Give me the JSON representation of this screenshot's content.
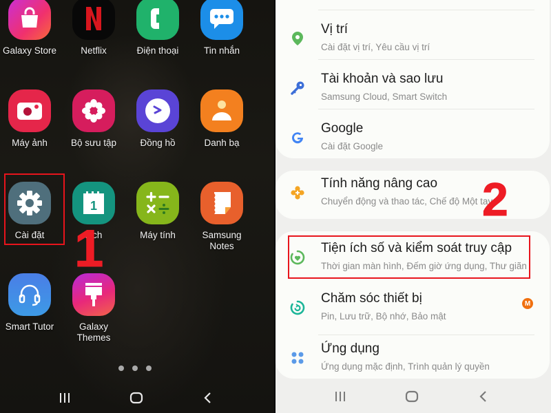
{
  "home_screen": {
    "apps": [
      {
        "label": "Galaxy Store",
        "icon": "shopping-bag-icon",
        "color": "#e0307a"
      },
      {
        "label": "Netflix",
        "icon": "netflix-n-icon",
        "color": "#000000"
      },
      {
        "label": "Điện thoại",
        "icon": "phone-icon",
        "color": "#21b06a"
      },
      {
        "label": "Tin nhắn",
        "icon": "chat-bubble-icon",
        "color": "#1e8ee6"
      },
      {
        "label": "Máy ảnh",
        "icon": "camera-icon",
        "color": "#e5264a"
      },
      {
        "label": "Bộ sưu tập",
        "icon": "flower-icon",
        "color": "#d61d5d"
      },
      {
        "label": "Đồng hồ",
        "icon": "clock-icon",
        "color": "#5a44d6"
      },
      {
        "label": "Danh bạ",
        "icon": "contact-icon",
        "color": "#f3801f"
      },
      {
        "label": "Cài đặt",
        "icon": "gear-icon",
        "color": "#4f6f7c"
      },
      {
        "label": "Lịch",
        "icon": "calendar-icon",
        "color": "#14947f"
      },
      {
        "label": "Máy tính",
        "icon": "calculator-icon",
        "color": "#86b61b"
      },
      {
        "label": "Samsung Notes",
        "icon": "notes-icon",
        "color": "#e8602c"
      },
      {
        "label": "Smart Tutor",
        "icon": "headset-icon",
        "color": "#3f86e0"
      },
      {
        "label": "Galaxy Themes",
        "icon": "paintbrush-icon",
        "color": "#d8269a"
      }
    ],
    "calendar_day": "1",
    "page_indicator_count": 3,
    "step_label": "1"
  },
  "settings_screen": {
    "groups": [
      {
        "items": [
          {
            "title": "Vị trí",
            "subtitle": "Cài đặt vị trí, Yêu cầu vị trí",
            "icon": "location-pin-icon",
            "icon_color": "#5cb85c"
          },
          {
            "title": "Tài khoản và sao lưu",
            "subtitle": "Samsung Cloud, Smart Switch",
            "icon": "key-icon",
            "icon_color": "#3d6fd8"
          },
          {
            "title": "Google",
            "subtitle": "Cài đặt Google",
            "icon": "google-g-icon",
            "icon_color": "#4285f4"
          }
        ]
      },
      {
        "items": [
          {
            "title": "Tính năng nâng cao",
            "subtitle": "Chuyển động và thao tác, Chế độ Một tay",
            "icon": "advanced-features-icon",
            "icon_color": "#f4a524"
          }
        ]
      },
      {
        "items": [
          {
            "title": "Tiện ích số và kiểm soát truy cập",
            "subtitle": "Thời gian màn hình, Đếm giờ ứng dụng, Thư giãn",
            "icon": "digital-wellbeing-icon",
            "icon_color": "#5cb85c"
          },
          {
            "title": "Chăm sóc thiết bị",
            "subtitle": "Pin, Lưu trữ, Bộ nhớ, Bảo mật",
            "icon": "device-care-icon",
            "icon_color": "#1bb598",
            "badge": "M"
          },
          {
            "title": "Ứng dụng",
            "subtitle": "Ứng dụng mặc định, Trình quản lý quyền",
            "icon": "apps-grid-icon",
            "icon_color": "#5b9ae8"
          }
        ]
      }
    ],
    "step_label": "2"
  },
  "navigation": {
    "recents": "recents-icon",
    "home": "home-icon",
    "back": "back-icon"
  },
  "colors": {
    "annotation_red": "#e8141c",
    "badge_orange": "#f07010"
  }
}
